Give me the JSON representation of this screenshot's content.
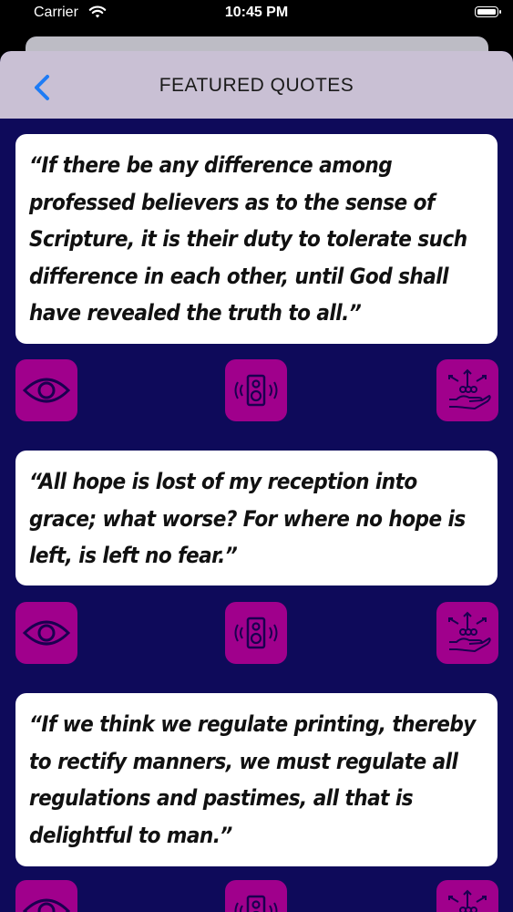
{
  "status_bar": {
    "carrier": "Carrier",
    "time": "10:45 PM",
    "wifi_icon": "wifi-icon",
    "battery_icon": "battery-icon"
  },
  "nav": {
    "title": "FEATURED QUOTES",
    "back_icon": "chevron-left-icon"
  },
  "colors": {
    "background": "#0e0a5a",
    "nav_bar": "#c9c0d4",
    "action_button": "#a0008c",
    "accent": "#1e7cf5",
    "card": "#ffffff"
  },
  "quotes": [
    {
      "text": "“If there be any difference among professed believers as to the sense of Scripture, it is their duty to tolerate such difference in each other, until God shall have revealed the truth to all.”",
      "actions": [
        "eye-icon",
        "speaker-icon",
        "hand-share-icon"
      ]
    },
    {
      "text": "“All hope is lost of my reception into grace; what worse? For where no hope is left, is left no fear.”",
      "actions": [
        "eye-icon",
        "speaker-icon",
        "hand-share-icon"
      ]
    },
    {
      "text": "“If we think we regulate printing, thereby to rectify manners, we must regulate all regulations and pastimes, all that is delightful to man.”",
      "actions": [
        "eye-icon",
        "speaker-icon",
        "hand-share-icon"
      ]
    }
  ]
}
